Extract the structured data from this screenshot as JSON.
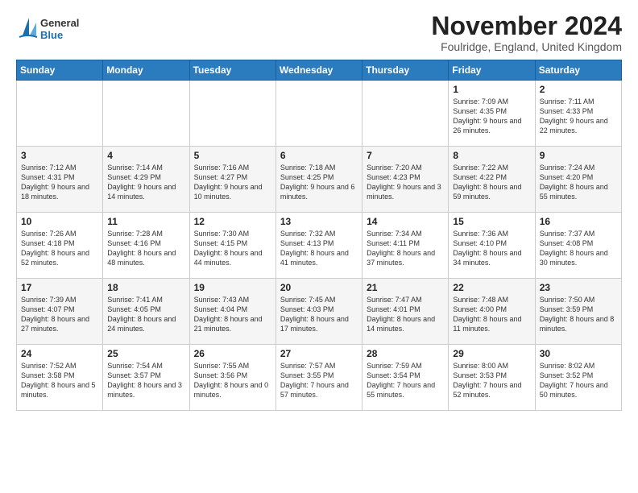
{
  "logo": {
    "line1": "General",
    "line2": "Blue"
  },
  "title": "November 2024",
  "location": "Foulridge, England, United Kingdom",
  "days_of_week": [
    "Sunday",
    "Monday",
    "Tuesday",
    "Wednesday",
    "Thursday",
    "Friday",
    "Saturday"
  ],
  "weeks": [
    [
      {
        "day": "",
        "info": ""
      },
      {
        "day": "",
        "info": ""
      },
      {
        "day": "",
        "info": ""
      },
      {
        "day": "",
        "info": ""
      },
      {
        "day": "",
        "info": ""
      },
      {
        "day": "1",
        "info": "Sunrise: 7:09 AM\nSunset: 4:35 PM\nDaylight: 9 hours\nand 26 minutes."
      },
      {
        "day": "2",
        "info": "Sunrise: 7:11 AM\nSunset: 4:33 PM\nDaylight: 9 hours\nand 22 minutes."
      }
    ],
    [
      {
        "day": "3",
        "info": "Sunrise: 7:12 AM\nSunset: 4:31 PM\nDaylight: 9 hours\nand 18 minutes."
      },
      {
        "day": "4",
        "info": "Sunrise: 7:14 AM\nSunset: 4:29 PM\nDaylight: 9 hours\nand 14 minutes."
      },
      {
        "day": "5",
        "info": "Sunrise: 7:16 AM\nSunset: 4:27 PM\nDaylight: 9 hours\nand 10 minutes."
      },
      {
        "day": "6",
        "info": "Sunrise: 7:18 AM\nSunset: 4:25 PM\nDaylight: 9 hours\nand 6 minutes."
      },
      {
        "day": "7",
        "info": "Sunrise: 7:20 AM\nSunset: 4:23 PM\nDaylight: 9 hours\nand 3 minutes."
      },
      {
        "day": "8",
        "info": "Sunrise: 7:22 AM\nSunset: 4:22 PM\nDaylight: 8 hours\nand 59 minutes."
      },
      {
        "day": "9",
        "info": "Sunrise: 7:24 AM\nSunset: 4:20 PM\nDaylight: 8 hours\nand 55 minutes."
      }
    ],
    [
      {
        "day": "10",
        "info": "Sunrise: 7:26 AM\nSunset: 4:18 PM\nDaylight: 8 hours\nand 52 minutes."
      },
      {
        "day": "11",
        "info": "Sunrise: 7:28 AM\nSunset: 4:16 PM\nDaylight: 8 hours\nand 48 minutes."
      },
      {
        "day": "12",
        "info": "Sunrise: 7:30 AM\nSunset: 4:15 PM\nDaylight: 8 hours\nand 44 minutes."
      },
      {
        "day": "13",
        "info": "Sunrise: 7:32 AM\nSunset: 4:13 PM\nDaylight: 8 hours\nand 41 minutes."
      },
      {
        "day": "14",
        "info": "Sunrise: 7:34 AM\nSunset: 4:11 PM\nDaylight: 8 hours\nand 37 minutes."
      },
      {
        "day": "15",
        "info": "Sunrise: 7:36 AM\nSunset: 4:10 PM\nDaylight: 8 hours\nand 34 minutes."
      },
      {
        "day": "16",
        "info": "Sunrise: 7:37 AM\nSunset: 4:08 PM\nDaylight: 8 hours\nand 30 minutes."
      }
    ],
    [
      {
        "day": "17",
        "info": "Sunrise: 7:39 AM\nSunset: 4:07 PM\nDaylight: 8 hours\nand 27 minutes."
      },
      {
        "day": "18",
        "info": "Sunrise: 7:41 AM\nSunset: 4:05 PM\nDaylight: 8 hours\nand 24 minutes."
      },
      {
        "day": "19",
        "info": "Sunrise: 7:43 AM\nSunset: 4:04 PM\nDaylight: 8 hours\nand 21 minutes."
      },
      {
        "day": "20",
        "info": "Sunrise: 7:45 AM\nSunset: 4:03 PM\nDaylight: 8 hours\nand 17 minutes."
      },
      {
        "day": "21",
        "info": "Sunrise: 7:47 AM\nSunset: 4:01 PM\nDaylight: 8 hours\nand 14 minutes."
      },
      {
        "day": "22",
        "info": "Sunrise: 7:48 AM\nSunset: 4:00 PM\nDaylight: 8 hours\nand 11 minutes."
      },
      {
        "day": "23",
        "info": "Sunrise: 7:50 AM\nSunset: 3:59 PM\nDaylight: 8 hours\nand 8 minutes."
      }
    ],
    [
      {
        "day": "24",
        "info": "Sunrise: 7:52 AM\nSunset: 3:58 PM\nDaylight: 8 hours\nand 5 minutes."
      },
      {
        "day": "25",
        "info": "Sunrise: 7:54 AM\nSunset: 3:57 PM\nDaylight: 8 hours\nand 3 minutes."
      },
      {
        "day": "26",
        "info": "Sunrise: 7:55 AM\nSunset: 3:56 PM\nDaylight: 8 hours\nand 0 minutes."
      },
      {
        "day": "27",
        "info": "Sunrise: 7:57 AM\nSunset: 3:55 PM\nDaylight: 7 hours\nand 57 minutes."
      },
      {
        "day": "28",
        "info": "Sunrise: 7:59 AM\nSunset: 3:54 PM\nDaylight: 7 hours\nand 55 minutes."
      },
      {
        "day": "29",
        "info": "Sunrise: 8:00 AM\nSunset: 3:53 PM\nDaylight: 7 hours\nand 52 minutes."
      },
      {
        "day": "30",
        "info": "Sunrise: 8:02 AM\nSunset: 3:52 PM\nDaylight: 7 hours\nand 50 minutes."
      }
    ]
  ]
}
